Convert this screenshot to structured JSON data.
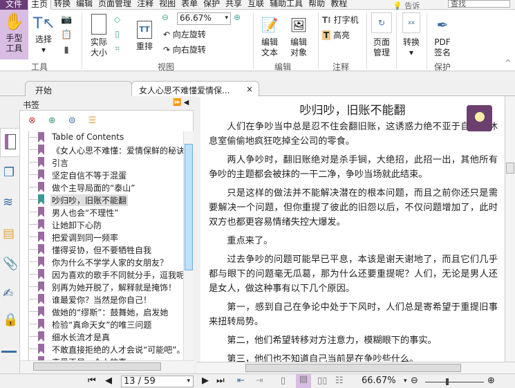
{
  "menu": {
    "file": "文件",
    "tabs": [
      "主页",
      "转换",
      "编辑",
      "页面管理",
      "注释",
      "视图",
      "表单",
      "保护",
      "共享",
      "互联",
      "辅助工具",
      "帮助",
      "教程"
    ],
    "tell": "告诉",
    "search_placeholder": "查找"
  },
  "ribbon": {
    "hand": "手型\n工具",
    "select": "选择",
    "actual": "实际\n大小",
    "reflow": "重排",
    "zoom": "66.67%",
    "rotate_left": "向左旋转",
    "rotate_right": "向右旋转",
    "edit_text": "编辑\n文本",
    "edit_object": "编辑\n对象",
    "typewriter": "打字机",
    "highlight": "高亮",
    "page_manage": "页面\n管理",
    "convert": "转换",
    "pdf_sign": "PDF\n签名",
    "groups": {
      "tools": "工具",
      "view": "视图",
      "edit": "编辑",
      "annot": "注释",
      "protect": "保护"
    }
  },
  "tabs": {
    "start": "开始",
    "doc": "女人心思不难懂爱情保..."
  },
  "bookmarks": {
    "title": "书签",
    "items": [
      "Table of Contents",
      "《女人心思不难懂：爱情保鲜的秘诀",
      "引言",
      "坚定自信不等于混蛋",
      "做个主导局面的“泰山”",
      "吵归吵，旧账不能翻",
      "男人也会“不理性”",
      "让她卸下心防",
      "把爱调到同一频率",
      "懂得妥协，但不要牺牲自我",
      "你为什么不学学人家的女朋友？",
      "因为喜欢的歌手不同就分手，逗我呢",
      "别再为她开脱了，解释就是掩饰！",
      "谁最爱你？当然是你自己！",
      "做她的“缪斯”：鼓舞她，启发她",
      "检验“真命天女”的唯三问题",
      "细水长流才是真",
      "不敢直接拒绝的人才会说“可能吧”。",
      "恋爱不是一个人的事"
    ],
    "selected": 5
  },
  "document": {
    "title": "吵归吵，旧账不能翻",
    "paragraphs": [
      "人们在争吵当中总是忍不住会翻旧账，这诱惑力绝不亚于自己在休息室偷偷地疯狂吃掉全公司的零食。",
      "两人争吵时，翻旧账绝对是杀手锏，大绝招，此招一出，其他所有争吵的主题都会被抹的一干二净，争吵当场就此结束。",
      "只是这样的做法并不能解决潜在的根本问题，而且之前你还只是需要解决一个问题，但你重提了彼此的旧怨以后，不仅问题增加了，此时双方也都更容易情绪失控大爆发。",
      "重点来了。",
      "过去争吵的问题可能早已平息，本该是谢天谢地了，而且它们几乎都与眼下的问题毫无瓜葛，那为什么还要重提呢？人们，无论是男人还是女人，做这种事有以下几个原因。",
      "第一，感到自己在争论中处于下风时，人们总是寄希望于重提旧事来扭转局势。",
      "第二，他们希望转移对方注意力，模糊眼下的事实。",
      "第三，他们也不知道自己当前是在争吵些什么。"
    ]
  },
  "status": {
    "page": "13 / 59",
    "zoom": "66.67%"
  },
  "colors": {
    "brand": "#6b3c7a",
    "hand_bg": "#d9bde3",
    "bookmark": "#9b6aa2",
    "bookmark_selected": "#3a9a94"
  }
}
